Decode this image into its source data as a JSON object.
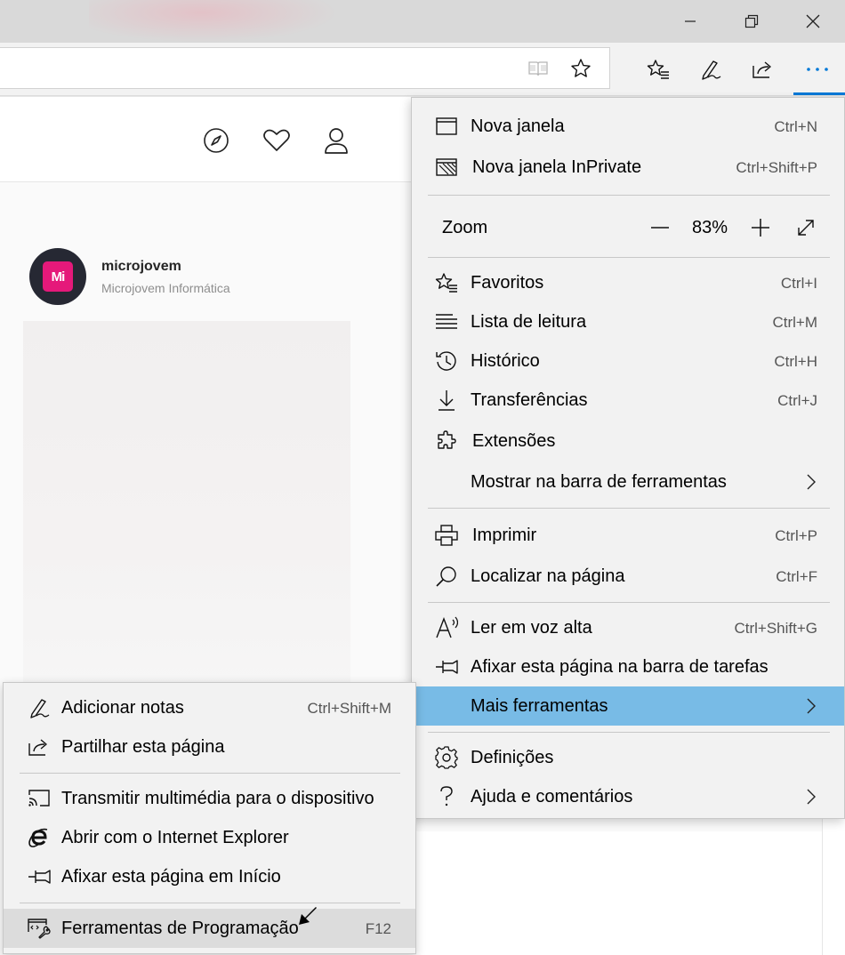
{
  "window": {
    "controls": [
      "minimize-icon",
      "restore-icon",
      "close-icon"
    ]
  },
  "toolbar": {
    "icons": [
      "reading-view-icon",
      "favorite-star-icon",
      "favorites-hub-icon",
      "notes-pen-icon",
      "share-icon",
      "more-icon"
    ],
    "accent": "#0078d7"
  },
  "page": {
    "header_icons": [
      "compass-icon",
      "heart-icon",
      "profile-icon"
    ],
    "profile": {
      "name": "microjovem",
      "subtitle": "Microjovem Informática",
      "logo_text": "Mi",
      "logo_color": "#e5197a"
    }
  },
  "menu": {
    "items_top": [
      {
        "label": "Nova janela",
        "shortcut": "Ctrl+N",
        "icon": "window-icon"
      },
      {
        "label": "Nova janela InPrivate",
        "shortcut": "Ctrl+Shift+P",
        "icon": "inprivate-icon"
      }
    ],
    "zoom": {
      "label": "Zoom",
      "value": "83%",
      "icons": [
        "zoom-out-icon",
        "zoom-in-icon",
        "fullscreen-icon"
      ]
    },
    "items_mid": [
      {
        "label": "Favoritos",
        "shortcut": "Ctrl+I",
        "icon": "favorites-icon"
      },
      {
        "label": "Lista de leitura",
        "shortcut": "Ctrl+M",
        "icon": "reading-list-icon"
      },
      {
        "label": "Histórico",
        "shortcut": "Ctrl+H",
        "icon": "history-icon"
      },
      {
        "label": "Transferências",
        "shortcut": "Ctrl+J",
        "icon": "download-icon"
      },
      {
        "label": "Extensões",
        "shortcut": "",
        "icon": "extensions-icon"
      },
      {
        "label": "Mostrar na barra de ferramentas",
        "shortcut": "",
        "icon": ""
      }
    ],
    "items_tools": [
      {
        "label": "Imprimir",
        "shortcut": "Ctrl+P",
        "icon": "print-icon"
      },
      {
        "label": "Localizar na página",
        "shortcut": "Ctrl+F",
        "icon": "find-icon"
      }
    ],
    "items_more": [
      {
        "label": "Ler em voz alta",
        "shortcut": "Ctrl+Shift+G",
        "icon": "read-aloud-icon"
      },
      {
        "label": "Afixar esta página na barra de tarefas",
        "shortcut": "",
        "icon": "pin-icon"
      },
      {
        "label": "Mais ferramentas",
        "shortcut": "",
        "icon": ""
      }
    ],
    "items_bottom": [
      {
        "label": "Definições",
        "shortcut": "",
        "icon": "settings-icon"
      },
      {
        "label": "Ajuda e comentários",
        "shortcut": "",
        "icon": "help-icon"
      }
    ],
    "highlight_color": "#78bbe6"
  },
  "submenu": {
    "items": [
      {
        "label": "Adicionar notas",
        "shortcut": "Ctrl+Shift+M",
        "icon": "notes-pen-icon"
      },
      {
        "label": "Partilhar esta página",
        "shortcut": "",
        "icon": "share-icon"
      },
      {
        "label": "Transmitir multimédia para o dispositivo",
        "shortcut": "",
        "icon": "cast-icon"
      },
      {
        "label": "Abrir com o Internet Explorer",
        "shortcut": "",
        "icon": "internet-explorer-icon"
      },
      {
        "label": "Afixar esta página em Início",
        "shortcut": "",
        "icon": "pin-icon"
      },
      {
        "label": "Ferramentas de Programação",
        "shortcut": "F12",
        "icon": "developer-tools-icon"
      }
    ]
  }
}
